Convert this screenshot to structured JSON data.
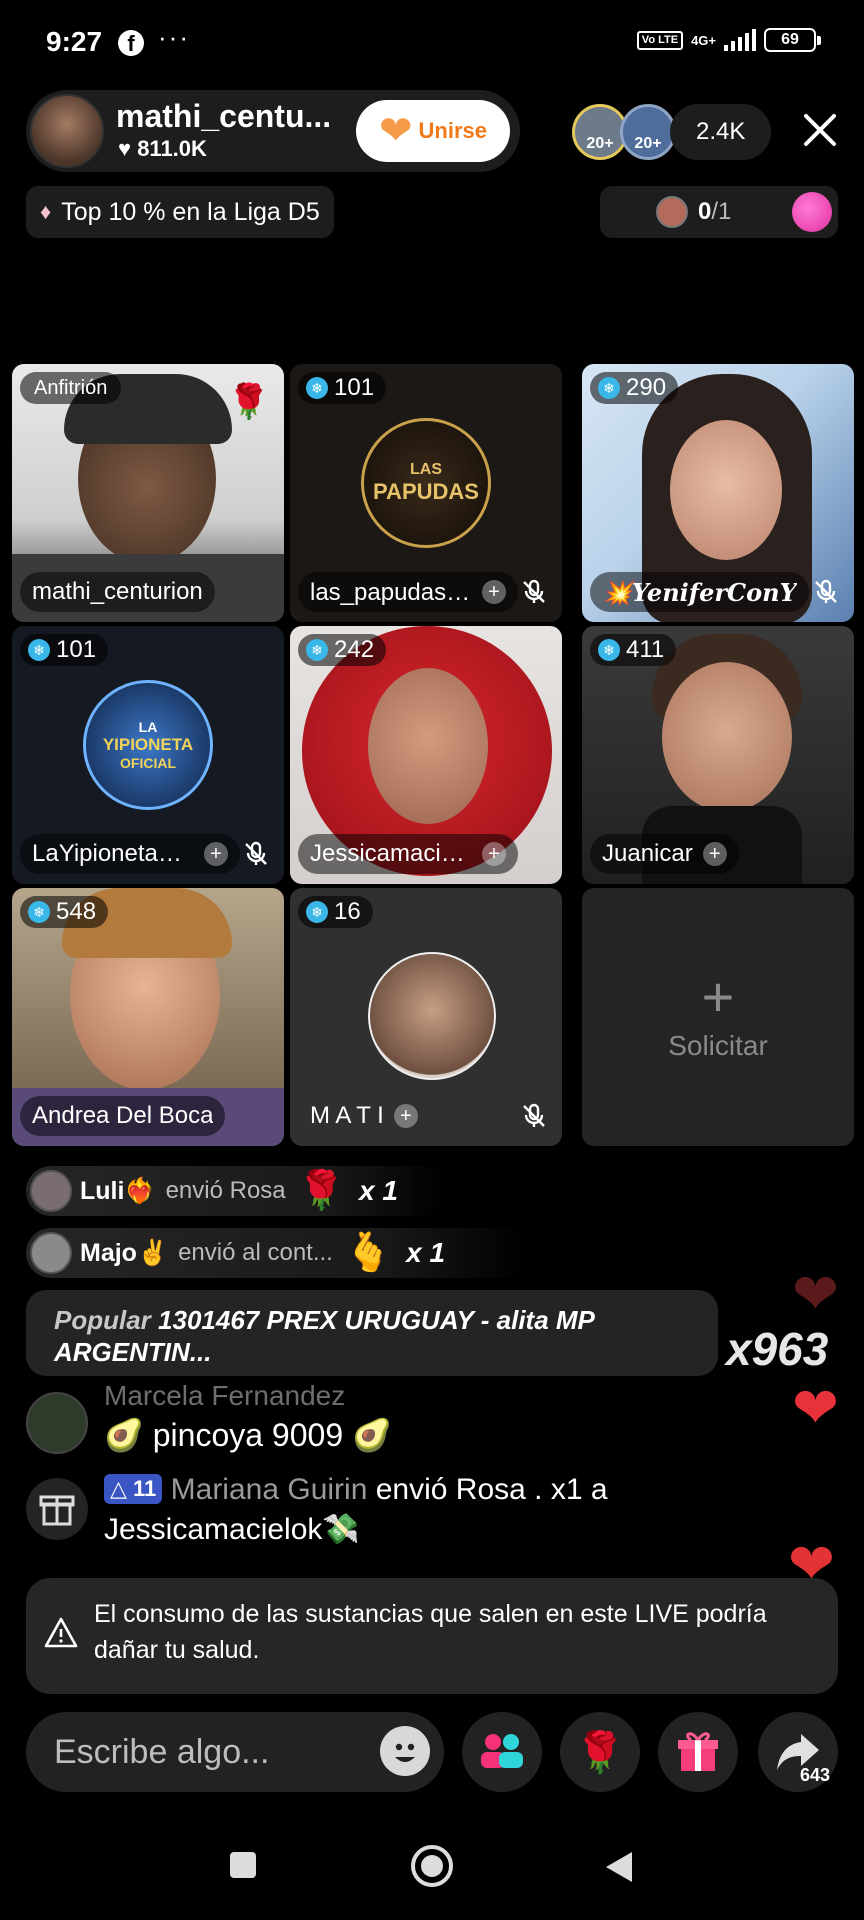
{
  "status_bar": {
    "time": "9:27",
    "dots": "···",
    "network": "4G+",
    "volte": "Vo LTE",
    "battery": "69"
  },
  "host": {
    "name": "mathi_centu...",
    "likes": "811.0K",
    "join_label": "Unirse"
  },
  "viewers": {
    "badge_a": "20+",
    "badge_b": "20+",
    "count": "2.4K"
  },
  "league": {
    "label": "Top 10 % en la Liga D5"
  },
  "goal": {
    "current": "0",
    "total": "/1"
  },
  "tiles": [
    {
      "name": "mathi_centurion",
      "tag": "Anfitrión"
    },
    {
      "name": "las_papudas🔥",
      "score": "101",
      "logo_line1": "LAS",
      "logo_line2": "PAPUDAS"
    },
    {
      "name": "💥YeniferConY",
      "score": "290"
    },
    {
      "name": "LaYipionetaO...",
      "score": "101",
      "logo_line1": "LA",
      "logo_line2": "YIPIONETA",
      "logo_line3": "OFICIAL"
    },
    {
      "name": "Jessicamacielok...",
      "score": "242"
    },
    {
      "name": "Juanicar",
      "score": "411"
    },
    {
      "name": "Andrea Del Boca",
      "score": "548"
    },
    {
      "name": "M A T I",
      "score": "16"
    },
    {
      "label": "Solicitar"
    }
  ],
  "gifts": [
    {
      "user": "Luli❤️‍🔥",
      "msg": "envió Rosa",
      "icon": "🌹",
      "count": "x 1"
    },
    {
      "user": "Majo✌️",
      "msg": "envió al cont...",
      "icon": "🫰",
      "count": "x 1"
    }
  ],
  "popular": {
    "label": "Popular",
    "text": "1301467 PREX URUGUAY - alita MP ARGENTIN..."
  },
  "combo": "x963",
  "chat": [
    {
      "user": "Marcela Fernandez",
      "text": "🥑  pincoya 9009 🥑"
    },
    {
      "level": "11",
      "user": "Mariana Guirin",
      "text": "envió Rosa .  x1 a Jessicamacielok💸"
    }
  ],
  "notice": "El consumo de las sustancias que salen en este LIVE podría dañar tu salud.",
  "input": {
    "placeholder": "Escribe algo..."
  },
  "share_count": "643",
  "colors": {
    "accent_orange": "#f07a1a",
    "heart_red": "#e8323a",
    "level_blue": "#3a56c4",
    "score_blue": "#39b7e8"
  }
}
